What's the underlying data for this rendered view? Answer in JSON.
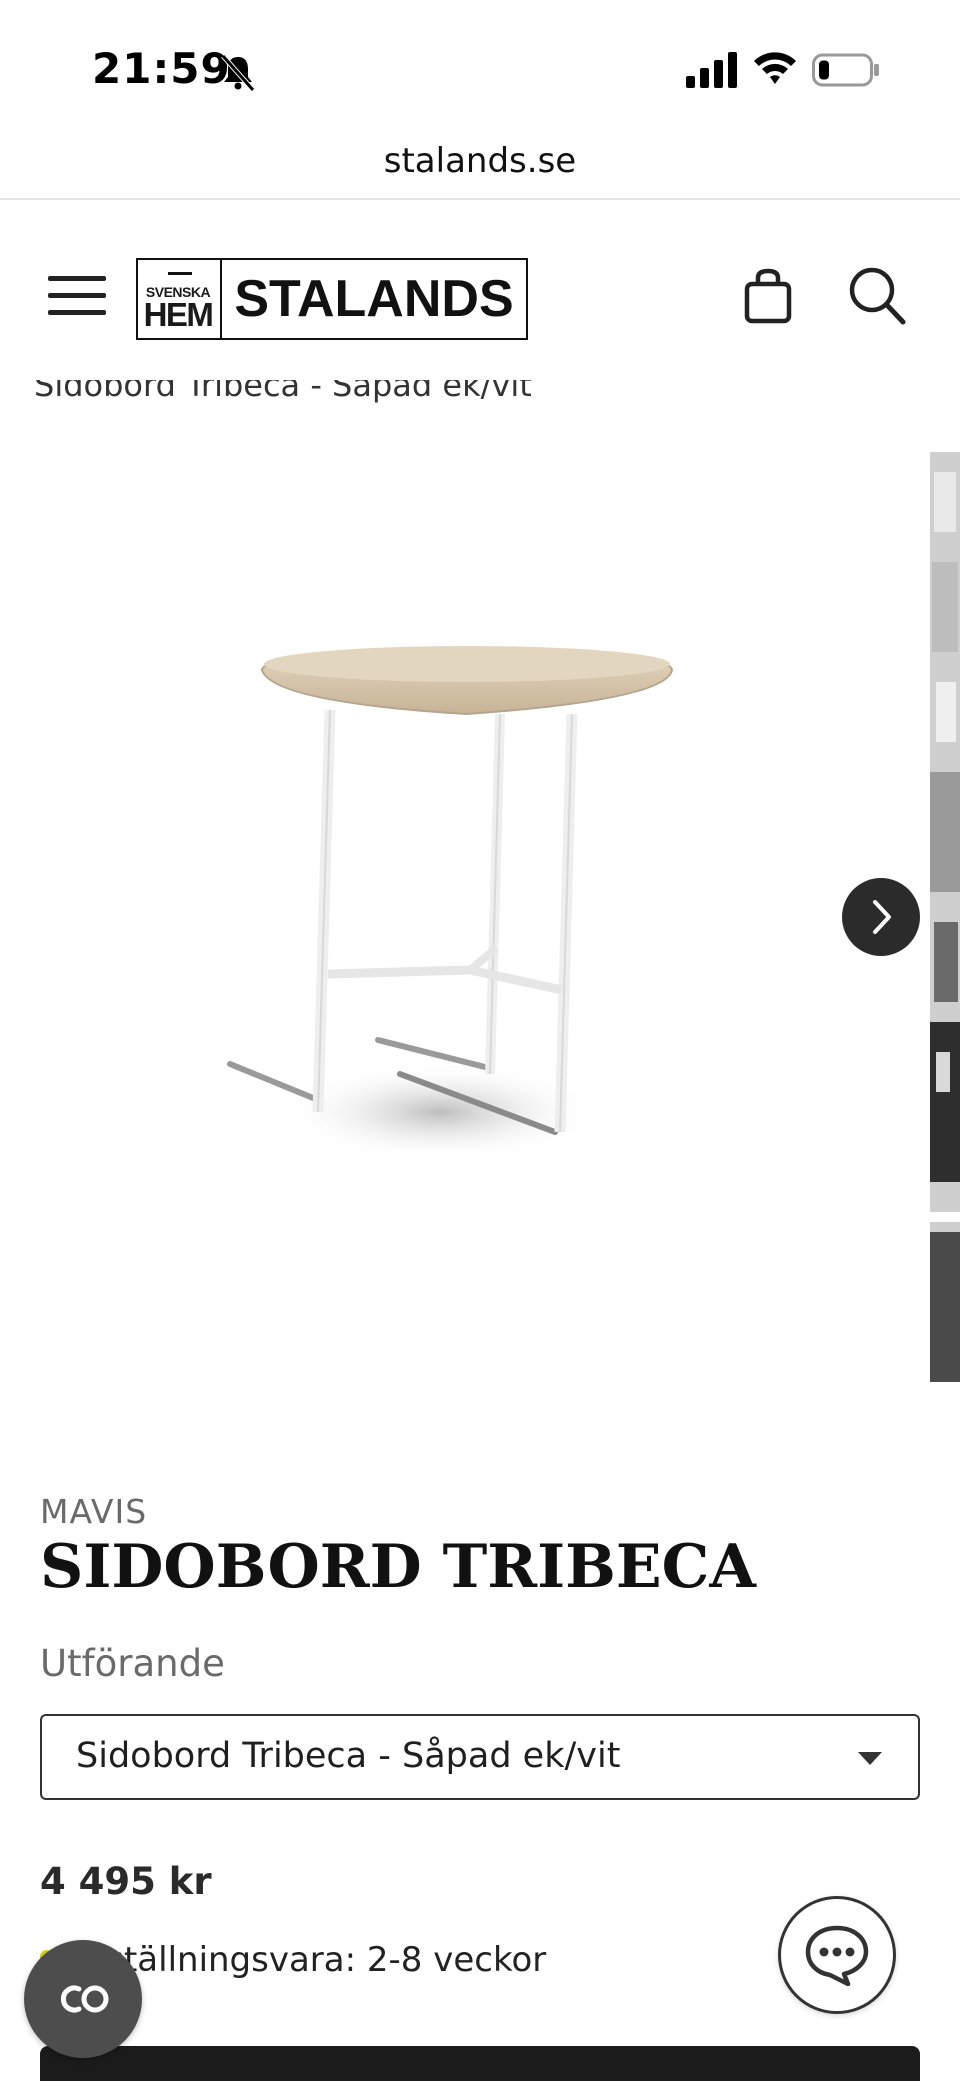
{
  "status_bar": {
    "time": "21:59",
    "icons": [
      "bell-slash-icon",
      "cellular-signal-icon",
      "wifi-icon",
      "battery-icon"
    ]
  },
  "browser": {
    "url": "stalands.se"
  },
  "header": {
    "logo": {
      "small_text": "SVENSKA",
      "hem_text": "HEM",
      "brand_text": "STALANDS"
    },
    "icons": [
      "menu-icon",
      "shopping-bag-icon",
      "search-icon"
    ]
  },
  "breadcrumb": {
    "current": "Sidobord Tribeca - Såpad ek/vit"
  },
  "gallery": {
    "image_description_icon": "side-table-image",
    "next_button_icon": "chevron-right-icon"
  },
  "product": {
    "brand": "MAVIS",
    "title": "SIDOBORD TRIBECA",
    "variant_label": "Utförande",
    "variant_selected": "Sidobord Tribeca - Såpad ek/vit",
    "price": "4 495 kr",
    "stock_text": "Beställningsvara: 2-8 veckor",
    "stock_color": "#d9d10f"
  },
  "floating": {
    "cookie_icon": "cookie-settings-icon",
    "chat_icon": "chat-bubble-icon"
  }
}
